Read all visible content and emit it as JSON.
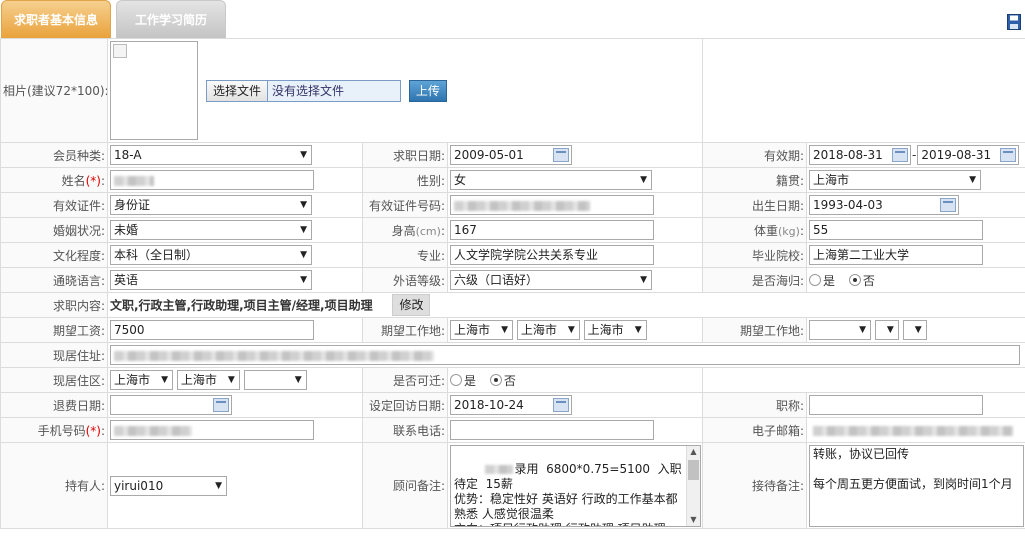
{
  "tabs": [
    "求职者基本信息",
    "工作学习简历"
  ],
  "photo": {
    "label": "相片(建议72*100):",
    "choose_file": "选择文件",
    "no_file": "没有选择文件",
    "upload": "上传"
  },
  "member_type": {
    "label": "会员种类:",
    "value": "18-A"
  },
  "job_date": {
    "label": "求职日期:",
    "value": "2009-05-01"
  },
  "valid_period": {
    "label": "有效期:",
    "start": "2018-08-31",
    "sep": "-",
    "end": "2019-08-31"
  },
  "name": {
    "label": "姓名",
    "req": "(*)",
    "colon": ":"
  },
  "gender": {
    "label": "性别:",
    "value": "女"
  },
  "native_place": {
    "label": "籍贯:",
    "value": "上海市"
  },
  "id_type": {
    "label": "有效证件:",
    "value": "身份证"
  },
  "id_number": {
    "label": "有效证件号码:"
  },
  "birth_date": {
    "label": "出生日期:",
    "value": "1993-04-03"
  },
  "marital": {
    "label": "婚姻状况:",
    "value": "未婚"
  },
  "height": {
    "label": "身高",
    "unit": "(cm)",
    "colon": ":",
    "value": "167"
  },
  "weight": {
    "label": "体重",
    "unit": "(kg)",
    "colon": ":",
    "value": "55"
  },
  "education": {
    "label": "文化程度:",
    "value": "本科（全日制）"
  },
  "major": {
    "label": "专业:",
    "value": "人文学院学院公共关系专业"
  },
  "school": {
    "label": "毕业院校:",
    "value": "上海第二工业大学"
  },
  "language": {
    "label": "通晓语言:",
    "value": "英语"
  },
  "foreign_level": {
    "label": "外语等级:",
    "value": "六级（口语好）"
  },
  "returnee": {
    "label": "是否海归:",
    "yes": "是",
    "no": "否"
  },
  "job_content": {
    "label": "求职内容:",
    "value": "文职,行政主管,行政助理,项目主管/经理,项目助理",
    "modify": "修改"
  },
  "expected_salary": {
    "label": "期望工资:",
    "value": "7500"
  },
  "expected_location1": {
    "label": "期望工作地:",
    "v1": "上海市",
    "v2": "上海市",
    "v3": "上海市"
  },
  "expected_location2": {
    "label": "期望工作地:"
  },
  "address": {
    "label": "现居住址:"
  },
  "district": {
    "label": "现居住区:",
    "v1": "上海市",
    "v2": "上海市"
  },
  "relocate": {
    "label": "是否可迁:",
    "yes": "是",
    "no": "否"
  },
  "refund_date": {
    "label": "退费日期:"
  },
  "visit_date": {
    "label": "设定回访日期:",
    "value": "2018-10-24"
  },
  "title": {
    "label": "职称:"
  },
  "mobile": {
    "label": "手机号码",
    "req": "(*)",
    "colon": ":"
  },
  "phone": {
    "label": "联系电话:"
  },
  "email": {
    "label": "电子邮箱:"
  },
  "holder": {
    "label": "持有人:",
    "value": "yirui010"
  },
  "advisor_note": {
    "label": "顾问备注:",
    "text": "录用  6800*0.75=5100  入职待定  15薪\n优势：稳定性好 英语好 行政的工作基本都熟悉 人感觉很温柔\n方向：项目行政助理 行政助理 项目助理"
  },
  "reception_note": {
    "label": "接待备注:",
    "text": "转账，协议已回传\n\n每个周五更方便面试，到岗时间1个月"
  }
}
